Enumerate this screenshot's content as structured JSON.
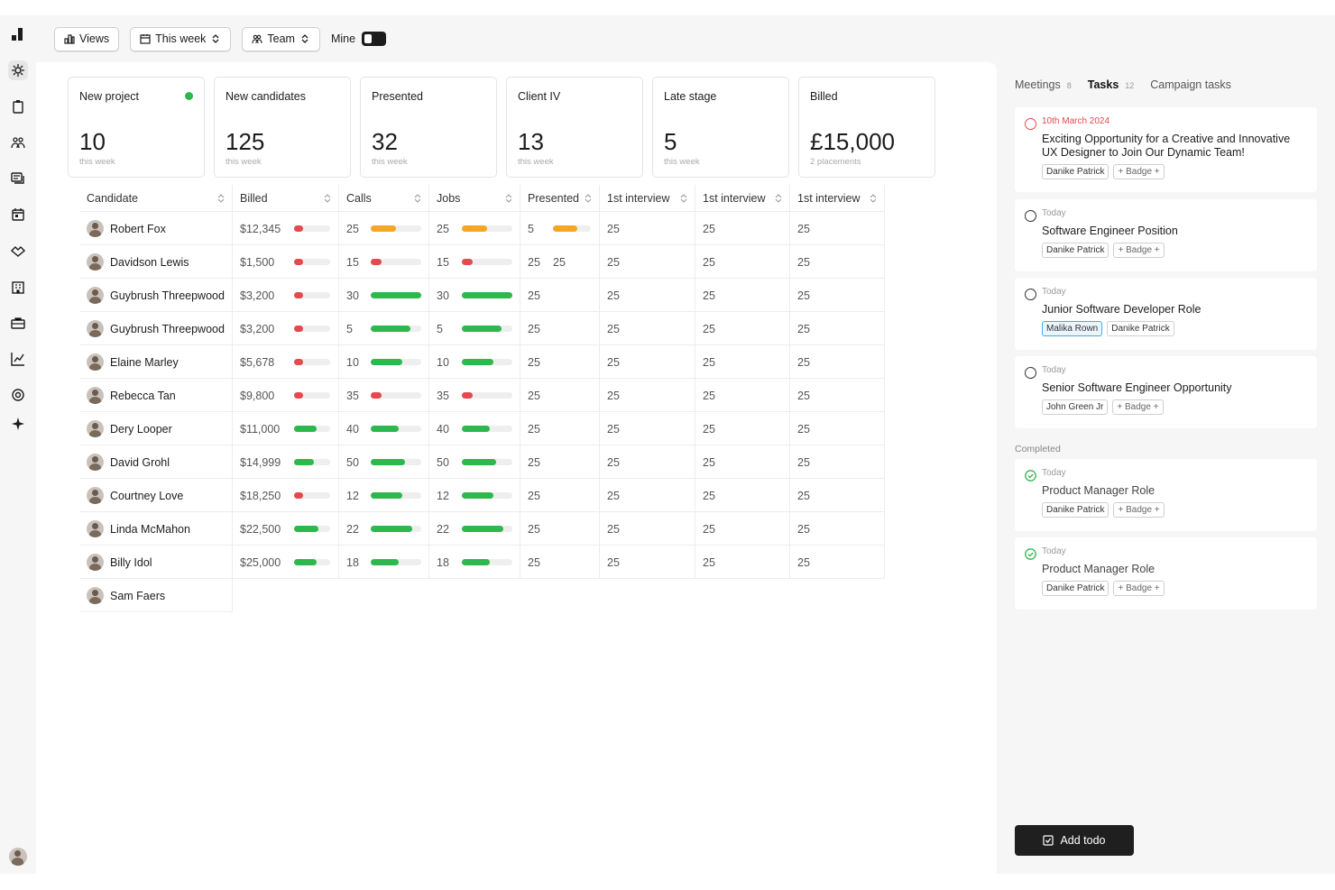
{
  "toolbar": {
    "views": "Views",
    "period": "This week",
    "team": "Team",
    "mine": "Mine"
  },
  "stats": [
    {
      "label": "New project",
      "value": "10",
      "sub": "this week",
      "indicator": true
    },
    {
      "label": "New candidates",
      "value": "125",
      "sub": "this week"
    },
    {
      "label": "Presented",
      "value": "32",
      "sub": "this week"
    },
    {
      "label": "Client IV",
      "value": "13",
      "sub": "this week"
    },
    {
      "label": "Late stage",
      "value": "5",
      "sub": "this week"
    },
    {
      "label": "Billed",
      "value": "£15,000",
      "sub": "2 placements"
    }
  ],
  "table": {
    "columns": [
      "Candidate",
      "Billed",
      "Calls",
      "Jobs",
      "Presented",
      "1st interview",
      "1st interview",
      "1st interview"
    ],
    "rows": [
      {
        "name": "Robert Fox",
        "billed": "$12,345",
        "billed_pct": 0.25,
        "billed_color": "#e5484d",
        "calls": "25",
        "calls_pct": 0.5,
        "calls_color": "#f5a623",
        "jobs": "25",
        "jobs_pct": 0.5,
        "jobs_color": "#f5a623",
        "presented": "5",
        "presented_extra": "",
        "presented_pct": 0.65,
        "presented_color": "#f5a623",
        "i1": "25",
        "i2": "25",
        "i3": "25"
      },
      {
        "name": "Davidson Lewis",
        "billed": "$1,500",
        "billed_pct": 0.25,
        "billed_color": "#e5484d",
        "calls": "15",
        "calls_pct": 0.22,
        "calls_color": "#e5484d",
        "jobs": "15",
        "jobs_pct": 0.22,
        "jobs_color": "#e5484d",
        "presented": "25",
        "presented_extra": "25",
        "presented_pct": 0,
        "presented_color": "#f5a623",
        "i1": "25",
        "i2": "25",
        "i3": "25"
      },
      {
        "name": "Guybrush Threepwood",
        "billed": "$3,200",
        "billed_pct": 0.25,
        "billed_color": "#e5484d",
        "calls": "30",
        "calls_pct": 1.0,
        "calls_color": "#2db84d",
        "jobs": "30",
        "jobs_pct": 1.0,
        "jobs_color": "#2db84d",
        "presented": "25",
        "presented_extra": "",
        "presented_pct": 0,
        "presented_color": "#2db84d",
        "i1": "25",
        "i2": "25",
        "i3": "25"
      },
      {
        "name": "Guybrush Threepwood",
        "billed": "$3,200",
        "billed_pct": 0.25,
        "billed_color": "#e5484d",
        "calls": "5",
        "calls_pct": 0.78,
        "calls_color": "#2db84d",
        "jobs": "5",
        "jobs_pct": 0.78,
        "jobs_color": "#2db84d",
        "presented": "25",
        "presented_extra": "",
        "presented_pct": 0,
        "presented_color": "#2db84d",
        "i1": "25",
        "i2": "25",
        "i3": "25"
      },
      {
        "name": "Elaine Marley",
        "billed": "$5,678",
        "billed_pct": 0.25,
        "billed_color": "#e5484d",
        "calls": "10",
        "calls_pct": 0.62,
        "calls_color": "#2db84d",
        "jobs": "10",
        "jobs_pct": 0.62,
        "jobs_color": "#2db84d",
        "presented": "25",
        "presented_extra": "",
        "presented_pct": 0,
        "presented_color": "#2db84d",
        "i1": "25",
        "i2": "25",
        "i3": "25"
      },
      {
        "name": "Rebecca Tan",
        "billed": "$9,800",
        "billed_pct": 0.25,
        "billed_color": "#e5484d",
        "calls": "35",
        "calls_pct": 0.22,
        "calls_color": "#e5484d",
        "jobs": "35",
        "jobs_pct": 0.22,
        "jobs_color": "#e5484d",
        "presented": "25",
        "presented_extra": "",
        "presented_pct": 0,
        "presented_color": "#2db84d",
        "i1": "25",
        "i2": "25",
        "i3": "25"
      },
      {
        "name": "Dery Looper",
        "billed": "$11,000",
        "billed_pct": 0.62,
        "billed_color": "#2db84d",
        "calls": "40",
        "calls_pct": 0.55,
        "calls_color": "#2db84d",
        "jobs": "40",
        "jobs_pct": 0.55,
        "jobs_color": "#2db84d",
        "presented": "25",
        "presented_extra": "",
        "presented_pct": 0,
        "presented_color": "#2db84d",
        "i1": "25",
        "i2": "25",
        "i3": "25"
      },
      {
        "name": "David Grohl",
        "billed": "$14,999",
        "billed_pct": 0.55,
        "billed_color": "#2db84d",
        "calls": "50",
        "calls_pct": 0.68,
        "calls_color": "#2db84d",
        "jobs": "50",
        "jobs_pct": 0.68,
        "jobs_color": "#2db84d",
        "presented": "25",
        "presented_extra": "",
        "presented_pct": 0,
        "presented_color": "#2db84d",
        "i1": "25",
        "i2": "25",
        "i3": "25"
      },
      {
        "name": "Courtney Love",
        "billed": "$18,250",
        "billed_pct": 0.25,
        "billed_color": "#e5484d",
        "calls": "12",
        "calls_pct": 0.62,
        "calls_color": "#2db84d",
        "jobs": "12",
        "jobs_pct": 0.62,
        "jobs_color": "#2db84d",
        "presented": "25",
        "presented_extra": "",
        "presented_pct": 0,
        "presented_color": "#2db84d",
        "i1": "25",
        "i2": "25",
        "i3": "25"
      },
      {
        "name": "Linda McMahon",
        "billed": "$22,500",
        "billed_pct": 0.68,
        "billed_color": "#2db84d",
        "calls": "22",
        "calls_pct": 0.82,
        "calls_color": "#2db84d",
        "jobs": "22",
        "jobs_pct": 0.82,
        "jobs_color": "#2db84d",
        "presented": "25",
        "presented_extra": "",
        "presented_pct": 0,
        "presented_color": "#2db84d",
        "i1": "25",
        "i2": "25",
        "i3": "25"
      },
      {
        "name": "Billy Idol",
        "billed": "$25,000",
        "billed_pct": 0.62,
        "billed_color": "#2db84d",
        "calls": "18",
        "calls_pct": 0.55,
        "calls_color": "#2db84d",
        "jobs": "18",
        "jobs_pct": 0.55,
        "jobs_color": "#2db84d",
        "presented": "25",
        "presented_extra": "",
        "presented_pct": 0,
        "presented_color": "#2db84d",
        "i1": "25",
        "i2": "25",
        "i3": "25"
      },
      {
        "name": "Sam Faers"
      }
    ]
  },
  "side": {
    "tabs": [
      {
        "label": "Meetings",
        "count": "8"
      },
      {
        "label": "Tasks",
        "count": "12",
        "active": true
      },
      {
        "label": "Campaign tasks",
        "count": ""
      }
    ],
    "tasks": [
      {
        "date": "10th March 2024",
        "overdue": true,
        "title": "Exciting Opportunity for a Creative and Innovative UX Designer to Join Our Dynamic Team!",
        "chips": [
          "Danike Patrick"
        ],
        "badge": "+ Badge +"
      },
      {
        "date": "Today",
        "title": "Software Engineer Position",
        "chips": [
          "Danike Patrick"
        ],
        "badge": "+ Badge +"
      },
      {
        "date": "Today",
        "title": "Junior Software Developer Role",
        "chips": [
          "Malika Rown",
          "Danike Patrick"
        ],
        "badge": ""
      },
      {
        "date": "Today",
        "title": "Senior Software Engineer Opportunity",
        "chips": [
          "John Green Jr"
        ],
        "badge": "+ Badge +"
      }
    ],
    "completed_label": "Completed",
    "completed": [
      {
        "date": "Today",
        "title": "Product Manager Role",
        "chips": [
          "Danike Patrick"
        ],
        "badge": "+ Badge +"
      },
      {
        "date": "Today",
        "title": "Product Manager Role",
        "chips": [
          "Danike Patrick"
        ],
        "badge": "+ Badge +"
      }
    ],
    "add_todo": "Add todo"
  },
  "colors": {
    "green": "#2db84d",
    "red": "#e5484d",
    "orange": "#f5a623",
    "dark": "#1f1f1f"
  }
}
